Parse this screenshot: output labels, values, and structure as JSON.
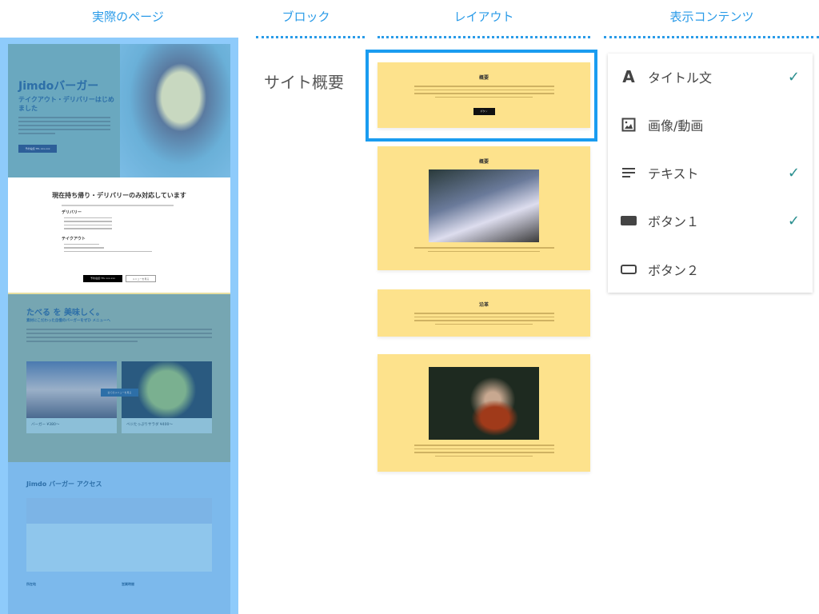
{
  "headers": {
    "actual": "実際のページ",
    "block": "ブロック",
    "layout": "レイアウト",
    "content": "表示コンテンツ"
  },
  "page": {
    "hero": {
      "title": "Jimdoバーガー",
      "subtitle": "テイクアウト・デリバリーはじめました",
      "button": "予約電話 TEL xxx-xxx"
    },
    "notice": {
      "title": "現在持ち帰り・デリバリーのみ対応しています",
      "delivery": "デリバリー",
      "takeout": "テイクアウト",
      "button1": "予約電話 TEL xxx-xxx",
      "button2": "メニューを見る"
    },
    "menu": {
      "title": "たべる を 美味しく。",
      "tagline": "素材にこだわった自慢のバーガーをぜひ メニューへ",
      "items": [
        "バーガー ¥380〜",
        "ベジたっぷりサラダ ¥400〜"
      ],
      "more": "全てのメニューを見る"
    },
    "access": {
      "title": "Jimdo バーガー アクセス",
      "address": "所在地",
      "hours": "営業時間"
    }
  },
  "block": {
    "label": "サイト概要"
  },
  "layouts": [
    {
      "title": "概要",
      "button": "ボタン"
    },
    {
      "title": "概要"
    },
    {
      "title": "沿革"
    },
    {}
  ],
  "content": {
    "items": [
      {
        "icon": "title-icon",
        "label": "タイトル文",
        "checked": true
      },
      {
        "icon": "image-icon",
        "label": "画像/動画",
        "checked": false
      },
      {
        "icon": "text-icon",
        "label": "テキスト",
        "checked": true
      },
      {
        "icon": "button-filled-icon",
        "label": "ボタン１",
        "checked": true
      },
      {
        "icon": "button-outline-icon",
        "label": "ボタン２",
        "checked": false
      }
    ],
    "check": "✓"
  },
  "colors": {
    "accent": "#1a9cf0",
    "card": "#fde28c",
    "check": "#2a8f8f"
  }
}
